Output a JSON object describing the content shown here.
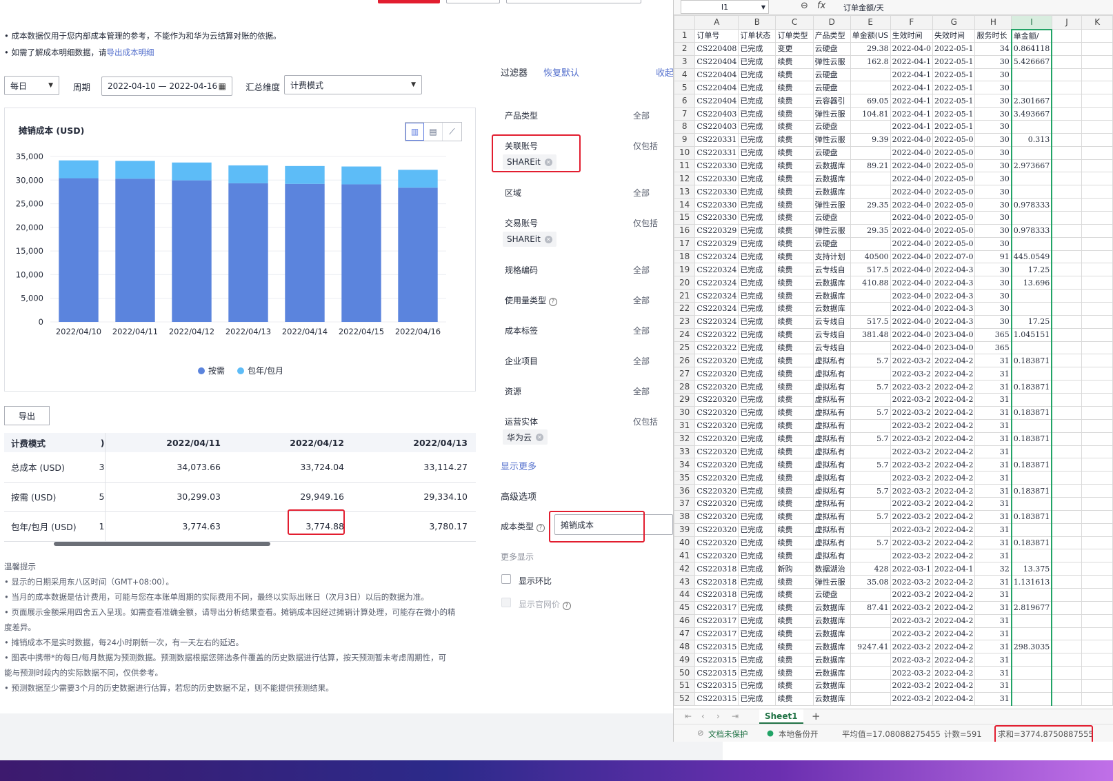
{
  "notes": {
    "line1": "成本数据仅用于您内部成本管理的参考，不能作为和华为云结算对账的依据。",
    "line2_prefix": "如需了解成本明细数据，请",
    "line2_link": "导出成本明细"
  },
  "controls": {
    "period_select": "每日",
    "period_label": "周期",
    "date_range": "2022-04-10 — 2022-04-16",
    "dimension_label": "汇总维度",
    "dimension_select": "计费模式"
  },
  "chart": {
    "title": "摊销成本 (USD)",
    "legend_on_demand": "按需",
    "legend_yearly": "包年/包月"
  },
  "chart_data": {
    "type": "bar",
    "stacked": true,
    "title": "摊销成本 (USD)",
    "categories": [
      "2022/04/10",
      "2022/04/11",
      "2022/04/12",
      "2022/04/13",
      "2022/04/14",
      "2022/04/15",
      "2022/04/16"
    ],
    "yticks": [
      "0",
      "5,000",
      "10,000",
      "15,000",
      "20,000",
      "25,000",
      "30,000",
      "35,000"
    ],
    "ylim": [
      0,
      35000
    ],
    "series": [
      {
        "name": "按需",
        "color": "#5b84dd",
        "values": [
          30400,
          30299,
          29949,
          29334,
          29200,
          29100,
          28400
        ]
      },
      {
        "name": "包年/包月",
        "color": "#5dbcf7",
        "values": [
          3774,
          3775,
          3775,
          3780,
          3780,
          3780,
          3780
        ]
      }
    ],
    "legend": "bottom"
  },
  "export_button": "导出",
  "cost_table": {
    "headers": [
      "计费模式",
      "2022/04/11",
      "2022/04/12",
      "2022/04/13"
    ],
    "rows": [
      [
        "总成本 (USD)",
        "34,073.66",
        "33,724.04",
        "33,114.27"
      ],
      [
        "按需 (USD)",
        "30,299.03",
        "29,949.16",
        "29,334.10"
      ],
      [
        "包年/包月 (USD)",
        "3,774.63",
        "3,774.88",
        "3,780.17"
      ]
    ],
    "partial_left": [
      "3",
      "5",
      "1"
    ]
  },
  "tips": {
    "title": "温馨提示",
    "lines": [
      "显示的日期采用东八区时间（GMT+08:00）。",
      "当月的成本数据是估计费用，可能与您在本账单周期的实际费用不同，最终以实际出账日（次月3日）以后的数据为准。",
      "页面展示金额采用四舍五入呈现。如需查看准确金额，请导出分析结果查看。摊销成本因经过摊销计算处理，可能存在微小的精",
      "度差异。",
      "摊销成本不是实时数据，每24小时刷新一次，有一天左右的延迟。",
      "图表中携带*的每日/每月数据为预测数据。预测数据根据您筛选条件覆盖的历史数据进行估算，按天预测暂未考虑周期性，可",
      "能与预测时段内的实际数据不同，仅供参考。",
      "预测数据至少需要3个月的历史数据进行估算，若您的历史数据不足，则不能提供预测结果。"
    ]
  },
  "filter": {
    "title": "过滤器",
    "reset": "恢复默认",
    "collapse": "收起",
    "items": [
      {
        "label": "产品类型",
        "value": "全部"
      },
      {
        "label": "关联账号",
        "value": "仅包括",
        "tag": "SHAREit"
      },
      {
        "label": "区域",
        "value": "全部"
      },
      {
        "label": "交易账号",
        "value": "仅包括",
        "tag": "SHAREit"
      },
      {
        "label": "规格编码",
        "value": "全部"
      },
      {
        "label": "使用量类型",
        "value": "全部"
      },
      {
        "label": "成本标签",
        "value": "全部"
      },
      {
        "label": "企业项目",
        "value": "全部"
      },
      {
        "label": "资源",
        "value": "全部"
      },
      {
        "label": "运营实体",
        "value": "仅包括",
        "tag": "华为云"
      }
    ],
    "show_more": "显示更多",
    "advanced": "高级选项",
    "cost_type_label": "成本类型",
    "cost_type_value": "摊销成本",
    "more_display": "更多显示",
    "show_mom": "显示环比",
    "show_official": "显示官网价"
  },
  "sheet": {
    "name_box": "I1",
    "formula": "订单金额/天",
    "columns": [
      "A",
      "B",
      "C",
      "D",
      "E",
      "F",
      "G",
      "H",
      "I",
      "J",
      "K"
    ],
    "header_row": [
      "订单号",
      "订单状态",
      "订单类型",
      "产品类型",
      "单金额(US",
      "生效时间",
      "失效时间",
      "服务时长",
      "单金额/",
      "",
      ""
    ],
    "rows": [
      [
        "CS220408",
        "已完成",
        "变更",
        "云硬盘",
        "29.38",
        "2022-04-0",
        "2022-05-1",
        "34",
        "0.864118"
      ],
      [
        "CS220404",
        "已完成",
        "续费",
        "弹性云服",
        "162.8",
        "2022-04-1",
        "2022-05-1",
        "30",
        "5.426667"
      ],
      [
        "CS220404",
        "已完成",
        "续费",
        "云硬盘",
        "",
        "2022-04-1",
        "2022-05-1",
        "30",
        ""
      ],
      [
        "CS220404",
        "已完成",
        "续费",
        "云硬盘",
        "",
        "2022-04-1",
        "2022-05-1",
        "30",
        ""
      ],
      [
        "CS220404",
        "已完成",
        "续费",
        "云容器引",
        "69.05",
        "2022-04-1",
        "2022-05-1",
        "30",
        "2.301667"
      ],
      [
        "CS220403",
        "已完成",
        "续费",
        "弹性云服",
        "104.81",
        "2022-04-1",
        "2022-05-1",
        "30",
        "3.493667"
      ],
      [
        "CS220403",
        "已完成",
        "续费",
        "云硬盘",
        "",
        "2022-04-1",
        "2022-05-1",
        "30",
        ""
      ],
      [
        "CS220331",
        "已完成",
        "续费",
        "弹性云服",
        "9.39",
        "2022-04-0",
        "2022-05-0",
        "30",
        "0.313"
      ],
      [
        "CS220331",
        "已完成",
        "续费",
        "云硬盘",
        "",
        "2022-04-0",
        "2022-05-0",
        "30",
        ""
      ],
      [
        "CS220330",
        "已完成",
        "续费",
        "云数据库",
        "89.21",
        "2022-04-0",
        "2022-05-0",
        "30",
        "2.973667"
      ],
      [
        "CS220330",
        "已完成",
        "续费",
        "云数据库",
        "",
        "2022-04-0",
        "2022-05-0",
        "30",
        ""
      ],
      [
        "CS220330",
        "已完成",
        "续费",
        "云数据库",
        "",
        "2022-04-0",
        "2022-05-0",
        "30",
        ""
      ],
      [
        "CS220330",
        "已完成",
        "续费",
        "弹性云服",
        "29.35",
        "2022-04-0",
        "2022-05-0",
        "30",
        "0.978333"
      ],
      [
        "CS220330",
        "已完成",
        "续费",
        "云硬盘",
        "",
        "2022-04-0",
        "2022-05-0",
        "30",
        ""
      ],
      [
        "CS220329",
        "已完成",
        "续费",
        "弹性云服",
        "29.35",
        "2022-04-0",
        "2022-05-0",
        "30",
        "0.978333"
      ],
      [
        "CS220329",
        "已完成",
        "续费",
        "云硬盘",
        "",
        "2022-04-0",
        "2022-05-0",
        "30",
        ""
      ],
      [
        "CS220324",
        "已完成",
        "续费",
        "支持计划",
        "40500",
        "2022-04-0",
        "2022-07-0",
        "91",
        "445.0549"
      ],
      [
        "CS220324",
        "已完成",
        "续费",
        "云专线自",
        "517.5",
        "2022-04-0",
        "2022-04-3",
        "30",
        "17.25"
      ],
      [
        "CS220324",
        "已完成",
        "续费",
        "云数据库",
        "410.88",
        "2022-04-0",
        "2022-04-3",
        "30",
        "13.696"
      ],
      [
        "CS220324",
        "已完成",
        "续费",
        "云数据库",
        "",
        "2022-04-0",
        "2022-04-3",
        "30",
        ""
      ],
      [
        "CS220324",
        "已完成",
        "续费",
        "云数据库",
        "",
        "2022-04-0",
        "2022-04-3",
        "30",
        ""
      ],
      [
        "CS220324",
        "已完成",
        "续费",
        "云专线自",
        "517.5",
        "2022-04-0",
        "2022-04-3",
        "30",
        "17.25"
      ],
      [
        "CS220322",
        "已完成",
        "续费",
        "云专线自",
        "381.48",
        "2022-04-0",
        "2023-04-0",
        "365",
        "1.045151"
      ],
      [
        "CS220322",
        "已完成",
        "续费",
        "云专线自",
        "",
        "2022-04-0",
        "2023-04-0",
        "365",
        ""
      ],
      [
        "CS220320",
        "已完成",
        "续费",
        "虚拟私有",
        "5.7",
        "2022-03-2",
        "2022-04-2",
        "31",
        "0.183871"
      ],
      [
        "CS220320",
        "已完成",
        "续费",
        "虚拟私有",
        "",
        "2022-03-2",
        "2022-04-2",
        "31",
        ""
      ],
      [
        "CS220320",
        "已完成",
        "续费",
        "虚拟私有",
        "5.7",
        "2022-03-2",
        "2022-04-2",
        "31",
        "0.183871"
      ],
      [
        "CS220320",
        "已完成",
        "续费",
        "虚拟私有",
        "",
        "2022-03-2",
        "2022-04-2",
        "31",
        ""
      ],
      [
        "CS220320",
        "已完成",
        "续费",
        "虚拟私有",
        "5.7",
        "2022-03-2",
        "2022-04-2",
        "31",
        "0.183871"
      ],
      [
        "CS220320",
        "已完成",
        "续费",
        "虚拟私有",
        "",
        "2022-03-2",
        "2022-04-2",
        "31",
        ""
      ],
      [
        "CS220320",
        "已完成",
        "续费",
        "虚拟私有",
        "5.7",
        "2022-03-2",
        "2022-04-2",
        "31",
        "0.183871"
      ],
      [
        "CS220320",
        "已完成",
        "续费",
        "虚拟私有",
        "",
        "2022-03-2",
        "2022-04-2",
        "31",
        ""
      ],
      [
        "CS220320",
        "已完成",
        "续费",
        "虚拟私有",
        "5.7",
        "2022-03-2",
        "2022-04-2",
        "31",
        "0.183871"
      ],
      [
        "CS220320",
        "已完成",
        "续费",
        "虚拟私有",
        "",
        "2022-03-2",
        "2022-04-2",
        "31",
        ""
      ],
      [
        "CS220320",
        "已完成",
        "续费",
        "虚拟私有",
        "5.7",
        "2022-03-2",
        "2022-04-2",
        "31",
        "0.183871"
      ],
      [
        "CS220320",
        "已完成",
        "续费",
        "虚拟私有",
        "",
        "2022-03-2",
        "2022-04-2",
        "31",
        ""
      ],
      [
        "CS220320",
        "已完成",
        "续费",
        "虚拟私有",
        "5.7",
        "2022-03-2",
        "2022-04-2",
        "31",
        "0.183871"
      ],
      [
        "CS220320",
        "已完成",
        "续费",
        "虚拟私有",
        "",
        "2022-03-2",
        "2022-04-2",
        "31",
        ""
      ],
      [
        "CS220320",
        "已完成",
        "续费",
        "虚拟私有",
        "5.7",
        "2022-03-2",
        "2022-04-2",
        "31",
        "0.183871"
      ],
      [
        "CS220320",
        "已完成",
        "续费",
        "虚拟私有",
        "",
        "2022-03-2",
        "2022-04-2",
        "31",
        ""
      ],
      [
        "CS220318",
        "已完成",
        "新购",
        "数据湖治",
        "428",
        "2022-03-1",
        "2022-04-1",
        "32",
        "13.375"
      ],
      [
        "CS220318",
        "已完成",
        "续费",
        "弹性云服",
        "35.08",
        "2022-03-2",
        "2022-04-2",
        "31",
        "1.131613"
      ],
      [
        "CS220318",
        "已完成",
        "续费",
        "云硬盘",
        "",
        "2022-03-2",
        "2022-04-2",
        "31",
        ""
      ],
      [
        "CS220317",
        "已完成",
        "续费",
        "云数据库",
        "87.41",
        "2022-03-2",
        "2022-04-2",
        "31",
        "2.819677"
      ],
      [
        "CS220317",
        "已完成",
        "续费",
        "云数据库",
        "",
        "2022-03-2",
        "2022-04-2",
        "31",
        ""
      ],
      [
        "CS220317",
        "已完成",
        "续费",
        "云数据库",
        "",
        "2022-03-2",
        "2022-04-2",
        "31",
        ""
      ],
      [
        "CS220315",
        "已完成",
        "续费",
        "云数据库",
        "9247.41",
        "2022-03-2",
        "2022-04-2",
        "31",
        "298.3035"
      ],
      [
        "CS220315",
        "已完成",
        "续费",
        "云数据库",
        "",
        "2022-03-2",
        "2022-04-2",
        "31",
        ""
      ],
      [
        "CS220315",
        "已完成",
        "续费",
        "云数据库",
        "",
        "2022-03-2",
        "2022-04-2",
        "31",
        ""
      ],
      [
        "CS220315",
        "已完成",
        "续费",
        "云数据库",
        "",
        "2022-03-2",
        "2022-04-2",
        "31",
        ""
      ],
      [
        "CS220315",
        "已完成",
        "续费",
        "云数据库",
        "",
        "2022-03-2",
        "2022-04-2",
        "31",
        ""
      ]
    ],
    "tab": "Sheet1",
    "add_tab": "+",
    "status": {
      "unprotected": "文档未保护",
      "backup": "本地备份开",
      "average": "平均值=17.08088275455",
      "count": "计数=591",
      "sum": "求和=3774.8750887555"
    }
  }
}
